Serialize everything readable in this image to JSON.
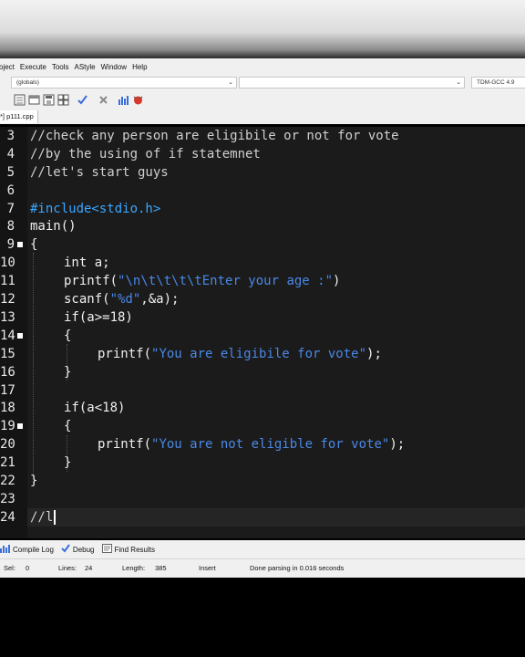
{
  "menu": [
    "oject",
    "Execute",
    "Tools",
    "AStyle",
    "Window",
    "Help"
  ],
  "combos": {
    "scope": "(globals)",
    "compiler": "TDM-GCC 4.9"
  },
  "tab": {
    "label": "*] p111.cpp"
  },
  "editor": {
    "lines": [
      {
        "n": "3"
      },
      {
        "n": "4"
      },
      {
        "n": "5"
      },
      {
        "n": "6"
      },
      {
        "n": "7"
      },
      {
        "n": "8"
      },
      {
        "n": "9"
      },
      {
        "n": "10"
      },
      {
        "n": "11"
      },
      {
        "n": "12"
      },
      {
        "n": "13"
      },
      {
        "n": "14"
      },
      {
        "n": "15"
      },
      {
        "n": "16"
      },
      {
        "n": "17"
      },
      {
        "n": "18"
      },
      {
        "n": "19"
      },
      {
        "n": "20"
      },
      {
        "n": "21"
      },
      {
        "n": "22"
      },
      {
        "n": "23"
      },
      {
        "n": "24"
      }
    ],
    "code": {
      "l3": "//check any person are eligibile or not for vote",
      "l4": "//by the using of if statemnet",
      "l5": "//let's start guys",
      "l7": "#include<stdio.h>",
      "l8": "main()",
      "l9": "{",
      "l10": "int a;",
      "l11_a": "printf(",
      "l11_s": "\"\\n\\t\\t\\t\\tEnter your age :\"",
      "l11_b": ")",
      "l12_a": "scanf(",
      "l12_s": "\"%d\"",
      "l12_b": ",&a);",
      "l13": "if(a>=18)",
      "l14": "{",
      "l15_a": "printf(",
      "l15_s": "\"You are eligibile for vote\"",
      "l15_b": ");",
      "l16": "}",
      "l18": "if(a<18)",
      "l19": "{",
      "l20_a": "printf(",
      "l20_s": "\"You are not eligible for vote\"",
      "l20_b": ");",
      "l21": "}",
      "l22": "}",
      "l24": "//l"
    }
  },
  "bottom_tabs": {
    "compile_log": "Compile Log",
    "debug": "Debug",
    "find_results": "Find Results"
  },
  "status": {
    "sel_label": "Sel:",
    "sel": "0",
    "lines_label": "Lines:",
    "lines": "24",
    "length_label": "Length:",
    "length": "385",
    "mode": "Insert",
    "message": "Done parsing in 0.016 seconds"
  },
  "colors": {
    "editor_bg": "#1b1b1b",
    "string": "#4a88e6",
    "preprocessor": "#3aa6ff",
    "text": "#f0f0f0"
  },
  "icons": [
    "new-file-icon",
    "open-icon",
    "save-icon",
    "save-all-icon",
    "check-icon",
    "close-icon",
    "chart-icon",
    "debug-icon"
  ]
}
